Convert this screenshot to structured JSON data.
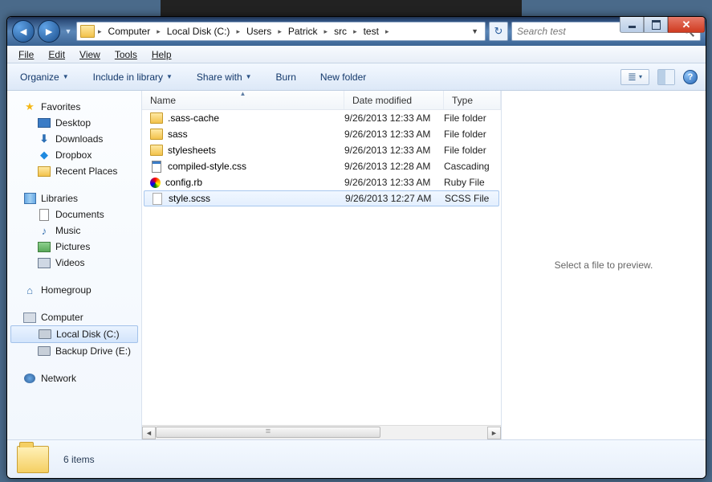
{
  "window_controls": {
    "min": "Minimize",
    "max": "Maximize",
    "close": "Close"
  },
  "breadcrumbs": [
    "Computer",
    "Local Disk (C:)",
    "Users",
    "Patrick",
    "src",
    "test"
  ],
  "search": {
    "placeholder": "Search test"
  },
  "menubar": {
    "file": "File",
    "edit": "Edit",
    "view": "View",
    "tools": "Tools",
    "help": "Help"
  },
  "cmdbar": {
    "organize": "Organize",
    "include": "Include in library",
    "share": "Share with",
    "burn": "Burn",
    "newfolder": "New folder"
  },
  "nav": {
    "favorites": {
      "label": "Favorites",
      "items": [
        "Desktop",
        "Downloads",
        "Dropbox",
        "Recent Places"
      ]
    },
    "libraries": {
      "label": "Libraries",
      "items": [
        "Documents",
        "Music",
        "Pictures",
        "Videos"
      ]
    },
    "homegroup": {
      "label": "Homegroup"
    },
    "computer": {
      "label": "Computer",
      "items": [
        "Local Disk (C:)",
        "Backup Drive (E:)"
      ]
    },
    "network": {
      "label": "Network"
    }
  },
  "columns": {
    "name": "Name",
    "date": "Date modified",
    "type": "Type"
  },
  "files": [
    {
      "icon": "folder",
      "name": ".sass-cache",
      "date": "9/26/2013 12:33 AM",
      "type": "File folder"
    },
    {
      "icon": "folder",
      "name": "sass",
      "date": "9/26/2013 12:33 AM",
      "type": "File folder"
    },
    {
      "icon": "folder",
      "name": "stylesheets",
      "date": "9/26/2013 12:33 AM",
      "type": "File folder"
    },
    {
      "icon": "css",
      "name": "compiled-style.css",
      "date": "9/26/2013 12:28 AM",
      "type": "Cascading"
    },
    {
      "icon": "cfg",
      "name": "config.rb",
      "date": "9/26/2013 12:33 AM",
      "type": "Ruby File"
    },
    {
      "icon": "file",
      "name": "style.scss",
      "date": "9/26/2013 12:27 AM",
      "type": "SCSS File",
      "selected": true
    }
  ],
  "preview": {
    "empty": "Select a file to preview."
  },
  "details": {
    "count": "6 items"
  }
}
